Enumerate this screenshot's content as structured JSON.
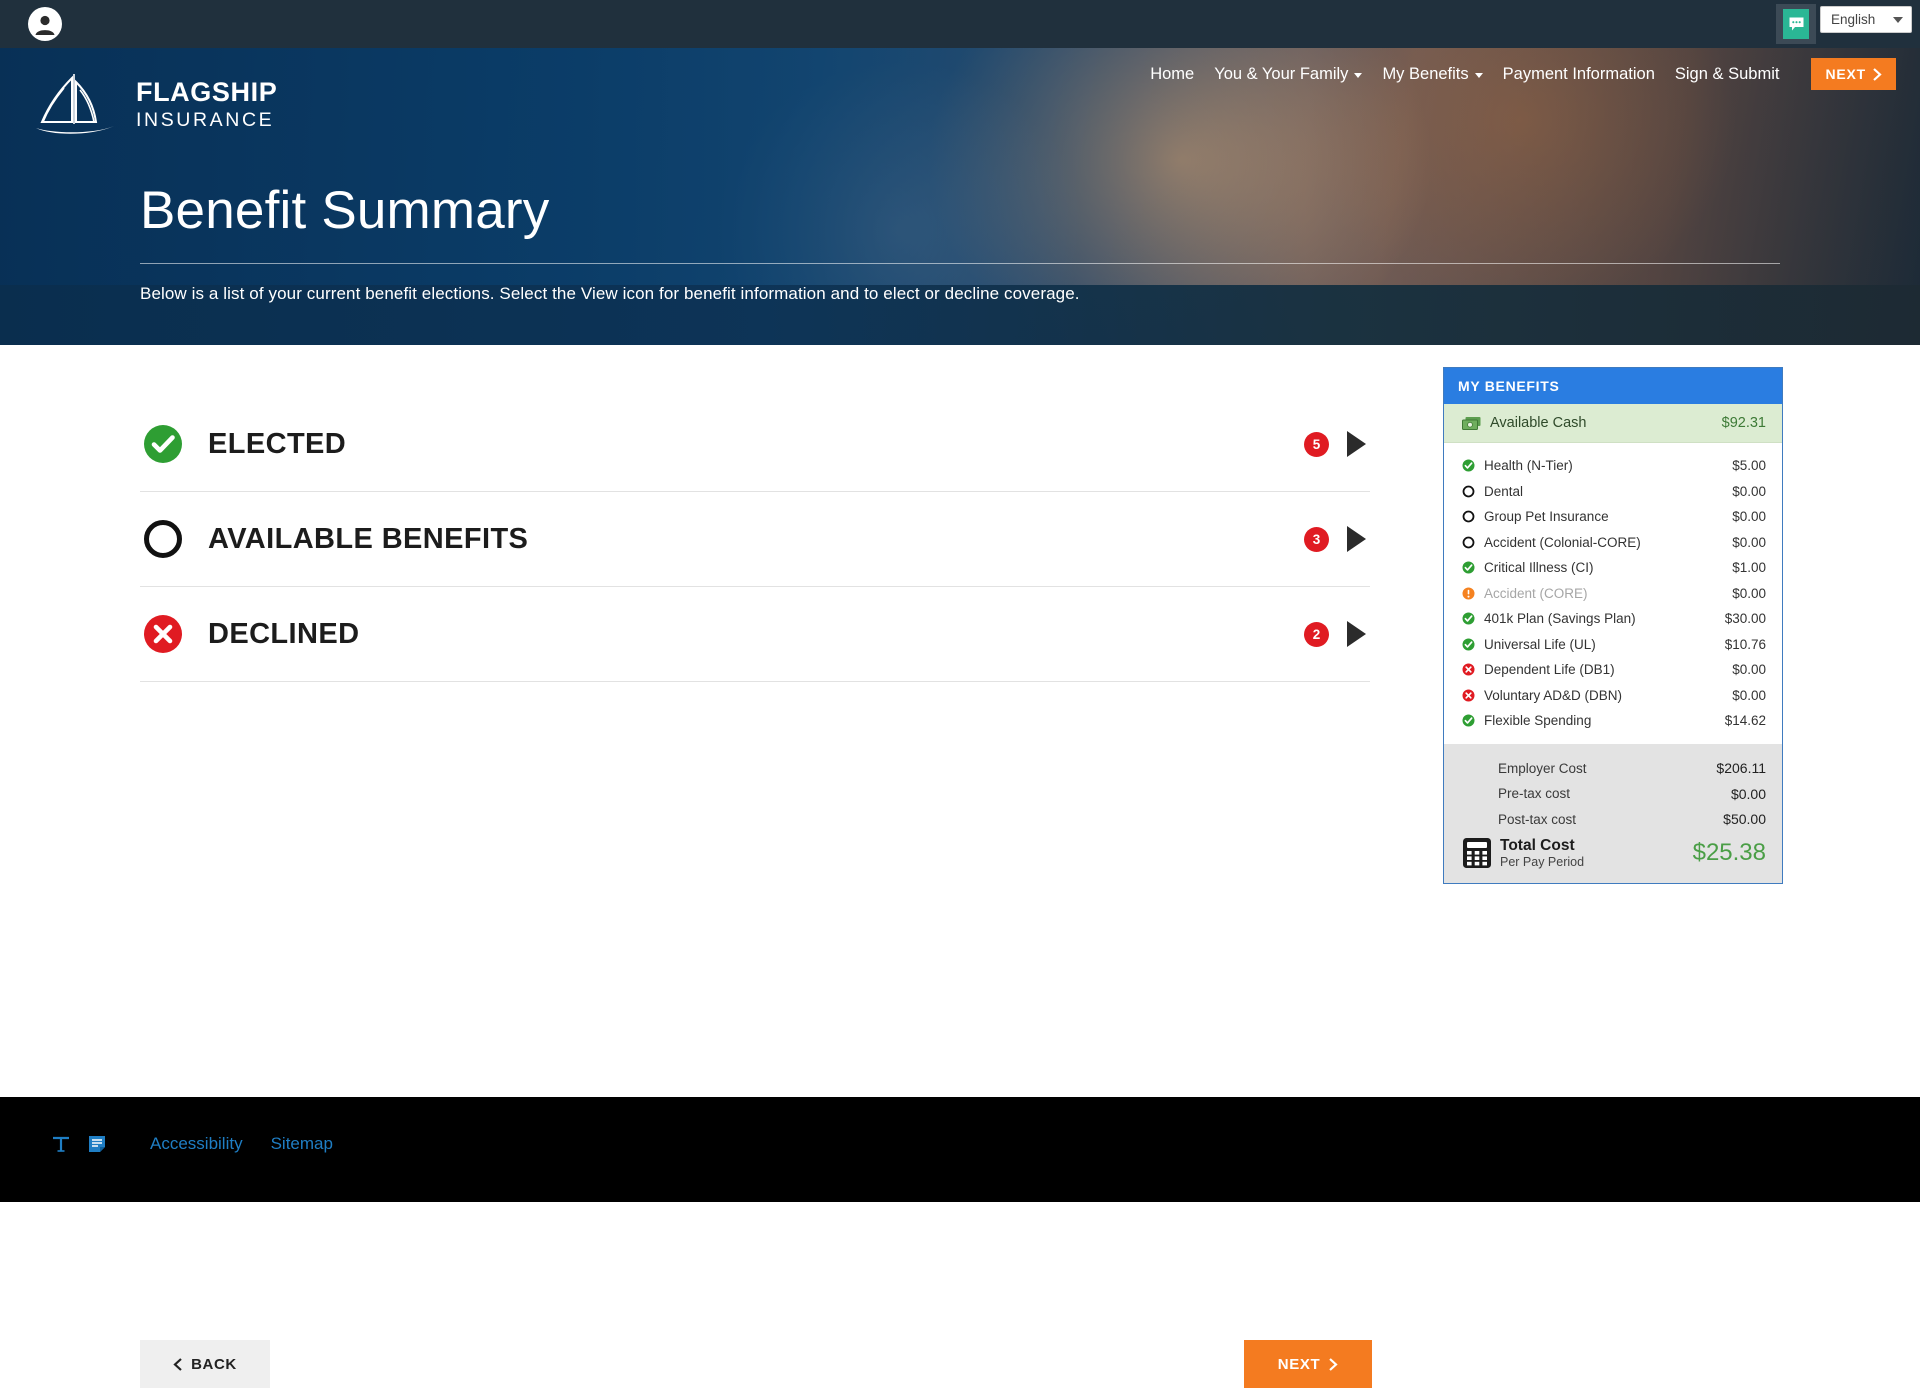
{
  "topbar": {
    "avatar_name": "user-avatar",
    "chat_label": "chat-icon",
    "language": "English"
  },
  "brand": {
    "line1": "FLAGSHIP",
    "line2": "INSURANCE"
  },
  "nav": {
    "items": [
      {
        "label": "Home",
        "has_caret": false
      },
      {
        "label": "You & Your Family",
        "has_caret": true
      },
      {
        "label": "My Benefits",
        "has_caret": true
      },
      {
        "label": "Payment Information",
        "has_caret": false
      },
      {
        "label": "Sign & Submit",
        "has_caret": false
      }
    ],
    "next_label": "NEXT"
  },
  "hero": {
    "title": "Benefit Summary",
    "subtitle": "Below is a list of your current benefit elections. Select the View icon for benefit information and to elect or decline coverage."
  },
  "accordions": [
    {
      "label": "ELECTED",
      "count": "5",
      "status": "elected"
    },
    {
      "label": "AVAILABLE BENEFITS",
      "count": "3",
      "status": "available"
    },
    {
      "label": "DECLINED",
      "count": "2",
      "status": "declined"
    }
  ],
  "panel": {
    "header": "MY BENEFITS",
    "cash_label": "Available Cash",
    "cash_value": "$92.31",
    "benefits": [
      {
        "name": "Health (N-Tier)",
        "value": "$5.00",
        "status": "elected"
      },
      {
        "name": "Dental",
        "value": "$0.00",
        "status": "available"
      },
      {
        "name": "Group Pet Insurance",
        "value": "$0.00",
        "status": "available"
      },
      {
        "name": "Accident (Colonial-CORE)",
        "value": "$0.00",
        "status": "available"
      },
      {
        "name": "Critical Illness (CI)",
        "value": "$1.00",
        "status": "elected"
      },
      {
        "name": "Accident (CORE)",
        "value": "$0.00",
        "status": "pending"
      },
      {
        "name": "401k Plan (Savings Plan)",
        "value": "$30.00",
        "status": "elected"
      },
      {
        "name": "Universal Life (UL)",
        "value": "$10.76",
        "status": "elected"
      },
      {
        "name": "Dependent Life (DB1)",
        "value": "$0.00",
        "status": "declined"
      },
      {
        "name": "Voluntary AD&D (DBN)",
        "value": "$0.00",
        "status": "declined"
      },
      {
        "name": "Flexible Spending",
        "value": "$14.62",
        "status": "elected"
      }
    ],
    "costs": [
      {
        "label": "Employer Cost",
        "value": "$206.11"
      },
      {
        "label": "Pre-tax cost",
        "value": "$0.00"
      },
      {
        "label": "Post-tax cost",
        "value": "$50.00"
      }
    ],
    "total_label": "Total Cost",
    "total_sub": "Per Pay Period",
    "total_value": "$25.38"
  },
  "actions": {
    "back_label": "BACK",
    "next_label": "NEXT"
  },
  "footer": {
    "accessibility": "Accessibility",
    "sitemap": "Sitemap"
  },
  "colors": {
    "accent_orange": "#f47b20",
    "panel_blue": "#2a7de1",
    "badge_red": "#e01b22",
    "status_green": "#2e9e33",
    "status_orange": "#f58220",
    "total_green": "#4a9e46",
    "link_blue": "#1f7ec4"
  }
}
